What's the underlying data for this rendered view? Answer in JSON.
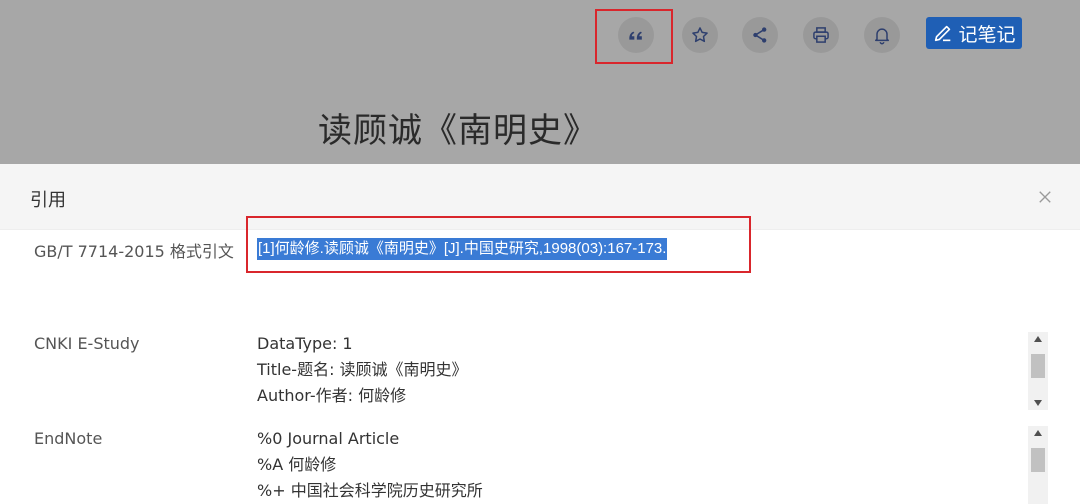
{
  "toolbar": {
    "note_label": "记笔记"
  },
  "article": {
    "title": "读顾诚《南明史》"
  },
  "modal": {
    "title": "引用",
    "rows": [
      {
        "label": "GB/T 7714-2015 格式引文",
        "text": "[1]何龄修.读顾诚《南明史》[J].中国史研究,1998(03):167-173."
      },
      {
        "label": "CNKI E-Study",
        "lines": [
          "DataType: 1",
          "Title-题名: 读顾诚《南明史》",
          "Author-作者: 何龄修"
        ]
      },
      {
        "label": "EndNote",
        "lines": [
          "%0 Journal Article",
          "%A 何龄修",
          "%+ 中国社会科学院历史研究所"
        ]
      }
    ]
  },
  "icons": {
    "quote": "quote-icon",
    "star": "star-icon",
    "share": "share-icon",
    "print": "printer-icon",
    "bell": "bell-icon",
    "pen": "pen-icon",
    "close": "close-icon"
  },
  "colors": {
    "highlight_border": "#d9262c",
    "note_button": "#1f5fb5",
    "selection": "#3a7bd5"
  }
}
